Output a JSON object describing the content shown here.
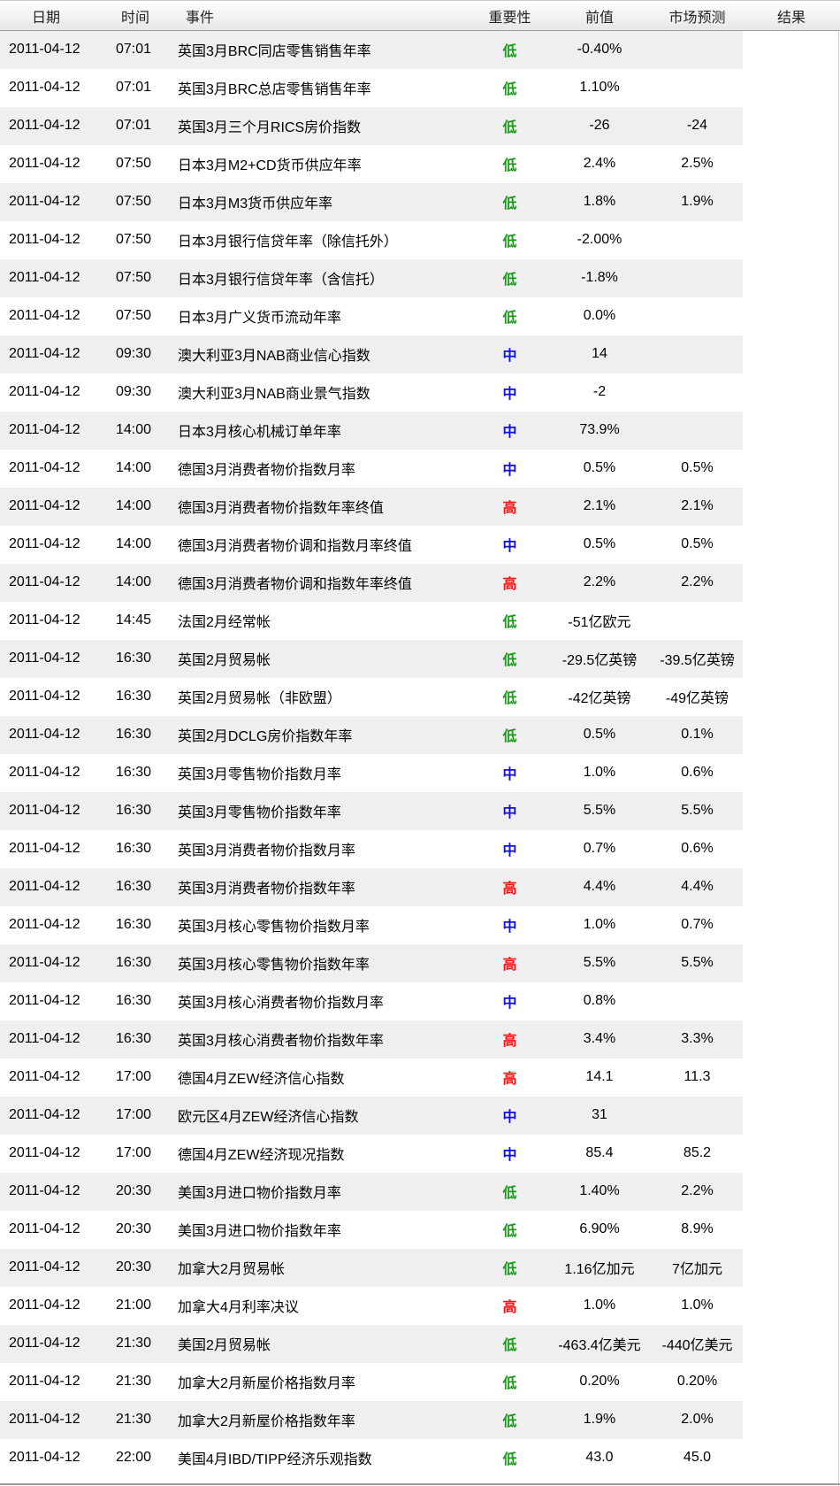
{
  "header": {
    "date": "日期",
    "time": "时间",
    "event": "事件",
    "importance": "重要性",
    "previous": "前值",
    "forecast": "市场预测",
    "result": "结果"
  },
  "importance_colors": {
    "低": "#1a9a1a",
    "中": "#1010e0",
    "高": "#ff1010"
  },
  "rows": [
    {
      "date": "2011-04-12",
      "time": "07:01",
      "event": "英国3月BRC同店零售销售年率",
      "importance": "低",
      "previous": "-0.40%",
      "forecast": "",
      "result": ""
    },
    {
      "date": "2011-04-12",
      "time": "07:01",
      "event": "英国3月BRC总店零售销售年率",
      "importance": "低",
      "previous": "1.10%",
      "forecast": "",
      "result": ""
    },
    {
      "date": "2011-04-12",
      "time": "07:01",
      "event": "英国3月三个月RICS房价指数",
      "importance": "低",
      "previous": "-26",
      "forecast": "-24",
      "result": ""
    },
    {
      "date": "2011-04-12",
      "time": "07:50",
      "event": "日本3月M2+CD货币供应年率",
      "importance": "低",
      "previous": "2.4%",
      "forecast": "2.5%",
      "result": ""
    },
    {
      "date": "2011-04-12",
      "time": "07:50",
      "event": "日本3月M3货币供应年率",
      "importance": "低",
      "previous": "1.8%",
      "forecast": "1.9%",
      "result": ""
    },
    {
      "date": "2011-04-12",
      "time": "07:50",
      "event": "日本3月银行信贷年率（除信托外）",
      "importance": "低",
      "previous": "-2.00%",
      "forecast": "",
      "result": ""
    },
    {
      "date": "2011-04-12",
      "time": "07:50",
      "event": "日本3月银行信贷年率（含信托）",
      "importance": "低",
      "previous": "-1.8%",
      "forecast": "",
      "result": ""
    },
    {
      "date": "2011-04-12",
      "time": "07:50",
      "event": "日本3月广义货币流动年率",
      "importance": "低",
      "previous": "0.0%",
      "forecast": "",
      "result": ""
    },
    {
      "date": "2011-04-12",
      "time": "09:30",
      "event": "澳大利亚3月NAB商业信心指数",
      "importance": "中",
      "previous": "14",
      "forecast": "",
      "result": ""
    },
    {
      "date": "2011-04-12",
      "time": "09:30",
      "event": "澳大利亚3月NAB商业景气指数",
      "importance": "中",
      "previous": "-2",
      "forecast": "",
      "result": ""
    },
    {
      "date": "2011-04-12",
      "time": "14:00",
      "event": "日本3月核心机械订单年率",
      "importance": "中",
      "previous": "73.9%",
      "forecast": "",
      "result": ""
    },
    {
      "date": "2011-04-12",
      "time": "14:00",
      "event": "德国3月消费者物价指数月率",
      "importance": "中",
      "previous": "0.5%",
      "forecast": "0.5%",
      "result": ""
    },
    {
      "date": "2011-04-12",
      "time": "14:00",
      "event": "德国3月消费者物价指数年率终值",
      "importance": "高",
      "previous": "2.1%",
      "forecast": "2.1%",
      "result": ""
    },
    {
      "date": "2011-04-12",
      "time": "14:00",
      "event": "德国3月消费者物价调和指数月率终值",
      "importance": "中",
      "previous": "0.5%",
      "forecast": "0.5%",
      "result": ""
    },
    {
      "date": "2011-04-12",
      "time": "14:00",
      "event": "德国3月消费者物价调和指数年率终值",
      "importance": "高",
      "previous": "2.2%",
      "forecast": "2.2%",
      "result": ""
    },
    {
      "date": "2011-04-12",
      "time": "14:45",
      "event": "法国2月经常帐",
      "importance": "低",
      "previous": "-51亿欧元",
      "forecast": "",
      "result": ""
    },
    {
      "date": "2011-04-12",
      "time": "16:30",
      "event": "英国2月贸易帐",
      "importance": "低",
      "previous": "-29.5亿英镑",
      "forecast": "-39.5亿英镑",
      "result": ""
    },
    {
      "date": "2011-04-12",
      "time": "16:30",
      "event": "英国2月贸易帐（非欧盟）",
      "importance": "低",
      "previous": "-42亿英镑",
      "forecast": "-49亿英镑",
      "result": ""
    },
    {
      "date": "2011-04-12",
      "time": "16:30",
      "event": "英国2月DCLG房价指数年率",
      "importance": "低",
      "previous": "0.5%",
      "forecast": "0.1%",
      "result": ""
    },
    {
      "date": "2011-04-12",
      "time": "16:30",
      "event": "英国3月零售物价指数月率",
      "importance": "中",
      "previous": "1.0%",
      "forecast": "0.6%",
      "result": ""
    },
    {
      "date": "2011-04-12",
      "time": "16:30",
      "event": "英国3月零售物价指数年率",
      "importance": "中",
      "previous": "5.5%",
      "forecast": "5.5%",
      "result": ""
    },
    {
      "date": "2011-04-12",
      "time": "16:30",
      "event": "英国3月消费者物价指数月率",
      "importance": "中",
      "previous": "0.7%",
      "forecast": "0.6%",
      "result": ""
    },
    {
      "date": "2011-04-12",
      "time": "16:30",
      "event": "英国3月消费者物价指数年率",
      "importance": "高",
      "previous": "4.4%",
      "forecast": "4.4%",
      "result": ""
    },
    {
      "date": "2011-04-12",
      "time": "16:30",
      "event": "英国3月核心零售物价指数月率",
      "importance": "中",
      "previous": "1.0%",
      "forecast": "0.7%",
      "result": ""
    },
    {
      "date": "2011-04-12",
      "time": "16:30",
      "event": "英国3月核心零售物价指数年率",
      "importance": "高",
      "previous": "5.5%",
      "forecast": "5.5%",
      "result": ""
    },
    {
      "date": "2011-04-12",
      "time": "16:30",
      "event": "英国3月核心消费者物价指数月率",
      "importance": "中",
      "previous": "0.8%",
      "forecast": "",
      "result": ""
    },
    {
      "date": "2011-04-12",
      "time": "16:30",
      "event": "英国3月核心消费者物价指数年率",
      "importance": "高",
      "previous": "3.4%",
      "forecast": "3.3%",
      "result": ""
    },
    {
      "date": "2011-04-12",
      "time": "17:00",
      "event": "德国4月ZEW经济信心指数",
      "importance": "高",
      "previous": "14.1",
      "forecast": "11.3",
      "result": ""
    },
    {
      "date": "2011-04-12",
      "time": "17:00",
      "event": "欧元区4月ZEW经济信心指数",
      "importance": "中",
      "previous": "31",
      "forecast": "",
      "result": ""
    },
    {
      "date": "2011-04-12",
      "time": "17:00",
      "event": "德国4月ZEW经济现况指数",
      "importance": "中",
      "previous": "85.4",
      "forecast": "85.2",
      "result": ""
    },
    {
      "date": "2011-04-12",
      "time": "20:30",
      "event": "美国3月进口物价指数月率",
      "importance": "低",
      "previous": "1.40%",
      "forecast": "2.2%",
      "result": ""
    },
    {
      "date": "2011-04-12",
      "time": "20:30",
      "event": "美国3月进口物价指数年率",
      "importance": "低",
      "previous": "6.90%",
      "forecast": "8.9%",
      "result": ""
    },
    {
      "date": "2011-04-12",
      "time": "20:30",
      "event": "加拿大2月贸易帐",
      "importance": "低",
      "previous": "1.16亿加元",
      "forecast": "7亿加元",
      "result": ""
    },
    {
      "date": "2011-04-12",
      "time": "21:00",
      "event": "加拿大4月利率决议",
      "importance": "高",
      "previous": "1.0%",
      "forecast": "1.0%",
      "result": ""
    },
    {
      "date": "2011-04-12",
      "time": "21:30",
      "event": "美国2月贸易帐",
      "importance": "低",
      "previous": "-463.4亿美元",
      "forecast": "-440亿美元",
      "result": ""
    },
    {
      "date": "2011-04-12",
      "time": "21:30",
      "event": "加拿大2月新屋价格指数月率",
      "importance": "低",
      "previous": "0.20%",
      "forecast": "0.20%",
      "result": ""
    },
    {
      "date": "2011-04-12",
      "time": "21:30",
      "event": "加拿大2月新屋价格指数年率",
      "importance": "低",
      "previous": "1.9%",
      "forecast": "2.0%",
      "result": ""
    },
    {
      "date": "2011-04-12",
      "time": "22:00",
      "event": "美国4月IBD/TIPP经济乐观指数",
      "importance": "低",
      "previous": "43.0",
      "forecast": "45.0",
      "result": ""
    }
  ]
}
